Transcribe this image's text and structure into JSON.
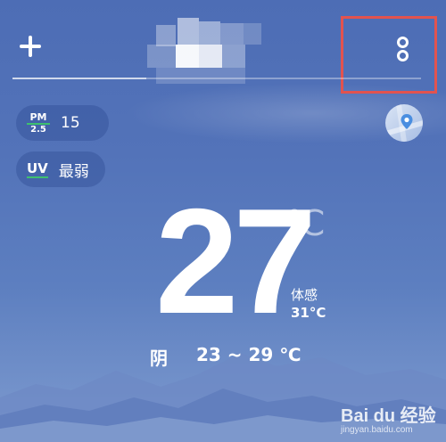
{
  "aqi": {
    "icon_top": "PM",
    "icon_bottom": "2.5",
    "value": "15"
  },
  "uv": {
    "icon": "UV",
    "value": "最弱"
  },
  "current": {
    "temperature": "27",
    "unit": "℃",
    "feels_label": "体感",
    "feels_value": "31°C",
    "condition": "阴",
    "range": "23 ~ 29 ℃"
  },
  "watermark": {
    "logo": "Bai du 经验",
    "url": "jingyan.baidu.com"
  },
  "colors": {
    "background": "#5373b9",
    "highlight": "#e2534f",
    "indicator": "#3ec06f"
  },
  "icons": {
    "add": "plus-icon",
    "more": "more-vertical-icon",
    "location": "location-pin-icon"
  }
}
